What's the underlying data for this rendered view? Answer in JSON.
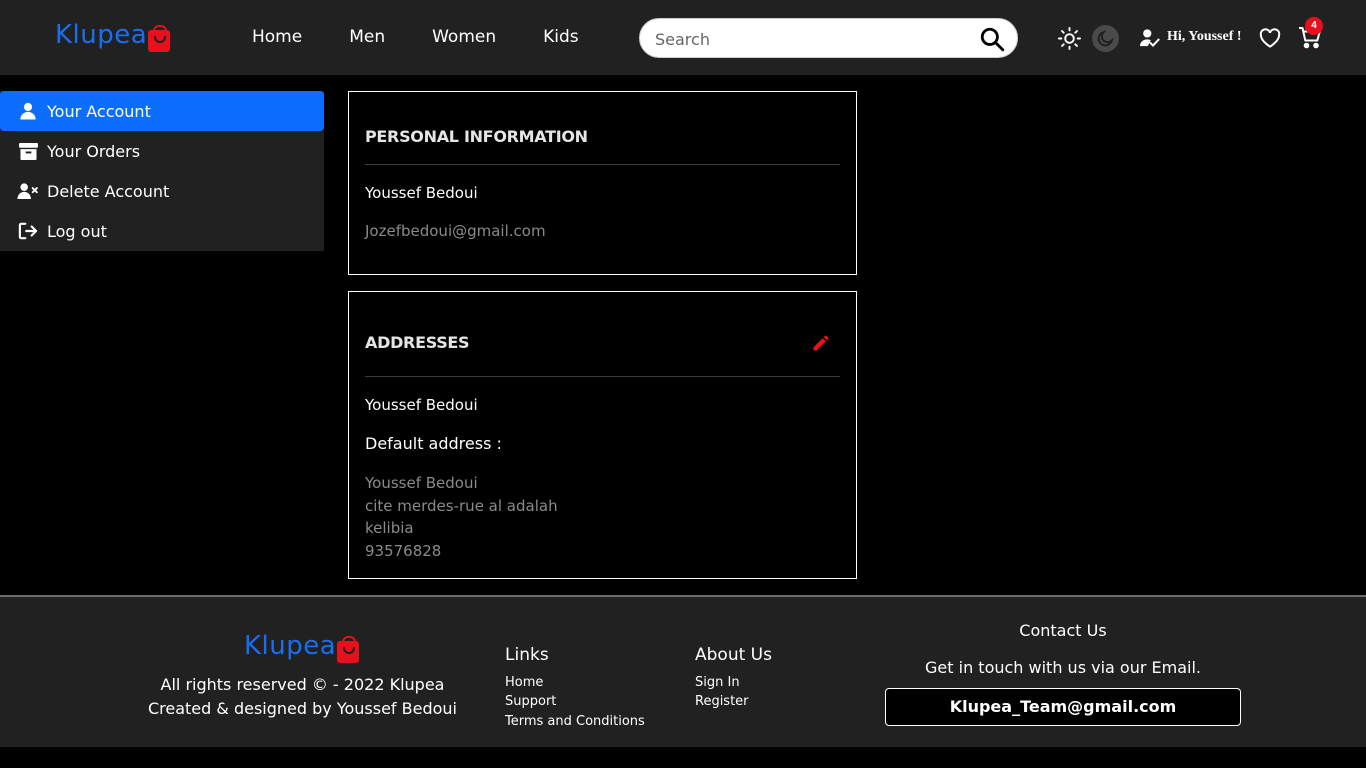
{
  "brand": {
    "name": "Klupea",
    "color": "#1a6ef0",
    "bag_color": "#e8101c"
  },
  "nav": [
    {
      "label": "Home"
    },
    {
      "label": "Men"
    },
    {
      "label": "Women"
    },
    {
      "label": "Kids"
    }
  ],
  "search": {
    "placeholder": "Search",
    "icon": "search-icon"
  },
  "header": {
    "greeting": "Hi, Youssef !",
    "cart_count": "4",
    "icons": [
      "sun-icon",
      "moon-icon",
      "user-check-icon",
      "heart-icon",
      "cart-icon"
    ]
  },
  "sidebar": {
    "accent": "#0d6efd",
    "items": [
      {
        "label": "Your Account",
        "icon": "user-icon",
        "active": true
      },
      {
        "label": "Your Orders",
        "icon": "archive-icon",
        "active": false
      },
      {
        "label": "Delete Account",
        "icon": "user-x-icon",
        "active": false
      },
      {
        "label": "Log out",
        "icon": "logout-icon",
        "active": false
      }
    ]
  },
  "personal": {
    "title": "PERSONAL INFORMATION",
    "name": "Youssef Bedoui",
    "email": "Jozefbedoui@gmail.com"
  },
  "addresses": {
    "title": "ADDRESSES",
    "edit_icon": "pencil-icon",
    "edit_color": "#e8101c",
    "name": "Youssef Bedoui",
    "default_label": "Default address :",
    "lines": [
      "Youssef Bedoui",
      "cite merdes-rue al adalah",
      "kelibia",
      "93576828"
    ]
  },
  "footer": {
    "copyright": "All rights reserved © - 2022 Klupea",
    "credit": "Created & designed by Youssef Bedoui",
    "links_title": "Links",
    "links": [
      "Home",
      "Support",
      "Terms and Conditions"
    ],
    "about_title": "About Us",
    "about_links": [
      "Sign In",
      "Register"
    ],
    "contact_title": "Contact Us",
    "contact_text": "Get in touch with us via our Email.",
    "email": "Klupea_Team@gmail.com"
  }
}
